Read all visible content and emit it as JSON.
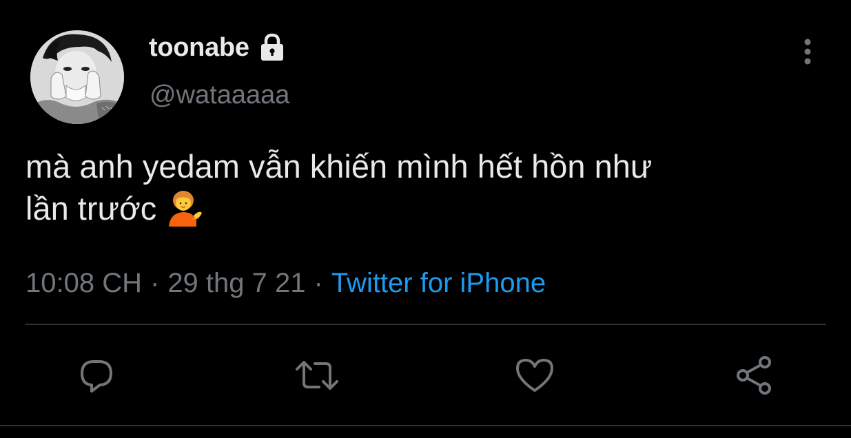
{
  "tweet": {
    "display_name": "toonabe",
    "handle": "@wataaaaa",
    "text_line1": "mà anh yedam vẫn khiến mình hết hồn như",
    "text_line2": "lần trước",
    "time": "10:08 CH",
    "date": "29 thg 7 21",
    "source": "Twitter for iPhone",
    "separator": "·"
  },
  "icons": {
    "lock": "lock-icon",
    "more": "more-vertical-icon",
    "emoji": "person-tipping-hand-emoji",
    "reply": "reply-icon",
    "retweet": "retweet-icon",
    "like": "heart-icon",
    "share": "share-icon"
  },
  "colors": {
    "background": "#000000",
    "primary_text": "#e7e9ea",
    "secondary_text": "#71767b",
    "link": "#1d9bf0",
    "divider": "#2f3336"
  }
}
